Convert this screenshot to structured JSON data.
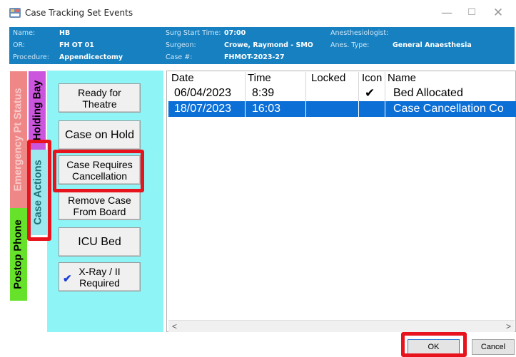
{
  "window": {
    "title": "Case Tracking Set Events",
    "minimize": "—",
    "maximize": "☐",
    "close": "✕"
  },
  "info": {
    "name_label": "Name:",
    "name_value": "HB",
    "or_label": "OR:",
    "or_value": "FH OT 01",
    "procedure_label": "Procedure:",
    "procedure_value": "Appendicectomy",
    "surg_start_label": "Surg Start Time:",
    "surg_start_value": "07:00",
    "surgeon_label": "Surgeon:",
    "surgeon_value": "Crowe, Raymond  - SMO",
    "case_label": "Case #:",
    "case_value": "FHMOT-2023-27",
    "anaesthesiologist_label": "Anesthesiologist:",
    "anaesthesiologist_value": "",
    "anes_type_label": "Anes. Type:",
    "anes_type_value": "General Anaesthesia"
  },
  "tabs": {
    "emergency": "Emergency Pt Status",
    "holding": "Holding Bay",
    "case_actions": "Case Actions",
    "postop": "Postop Phone"
  },
  "actions": {
    "ready": "Ready for\nTheatre",
    "hold": "Case on Hold",
    "cancellation": "Case Requires\nCancellation",
    "remove": "Remove Case\nFrom Board",
    "icu": "ICU Bed",
    "xray": "X-Ray / II\nRequired",
    "xray_checked": "✔"
  },
  "table": {
    "columns": [
      "Date",
      "Time",
      "Locked",
      "Icon",
      "Name"
    ],
    "rows": [
      {
        "date": "06/04/2023",
        "time": "8:39",
        "locked": "",
        "icon": "✔",
        "name": "Bed Allocated"
      },
      {
        "date": "18/07/2023",
        "time": "16:03",
        "locked": "",
        "icon": "",
        "name": "Case Cancellation Co"
      }
    ],
    "scroll_left": "<",
    "scroll_right": ">"
  },
  "buttons": {
    "ok": "OK",
    "cancel": "Cancel"
  },
  "colors": {
    "header_band": "#1780c0",
    "actions_panel": "#8ff4f6",
    "selected_row": "#0c6fd6",
    "highlight": "#e8141d"
  }
}
